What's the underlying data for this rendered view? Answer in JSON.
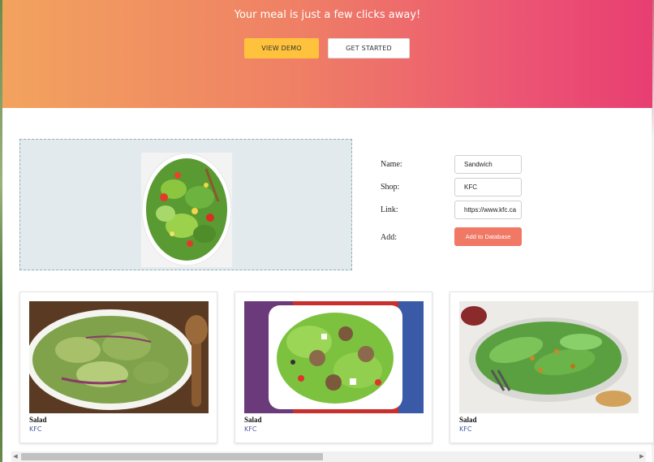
{
  "hero": {
    "title": "Your meal is just a few clicks away!",
    "view_demo_label": "VIEW DEMO",
    "get_started_label": "GET STARTED",
    "colors": {
      "gradient_start": "#f2a35e",
      "gradient_end": "#e83e72",
      "demo_button": "#ffc23c"
    }
  },
  "upload": {
    "preview_icon": "salad-preview-image"
  },
  "form": {
    "name_label": "Name:",
    "name_value": "Sandwich",
    "shop_label": "Shop:",
    "shop_value": "KFC",
    "link_label": "Link:",
    "link_value": "https://www.kfc.ca",
    "add_label": "Add:",
    "add_button_label": "Add to Database",
    "add_button_color": "#f07865"
  },
  "cards": [
    {
      "title": "Salad",
      "shop": "KFC",
      "image": "cucumber-salad-image"
    },
    {
      "title": "Salad",
      "shop": "KFC",
      "image": "meatball-salad-image"
    },
    {
      "title": "Salad",
      "shop": "KFC",
      "image": "romaine-salad-image"
    }
  ]
}
